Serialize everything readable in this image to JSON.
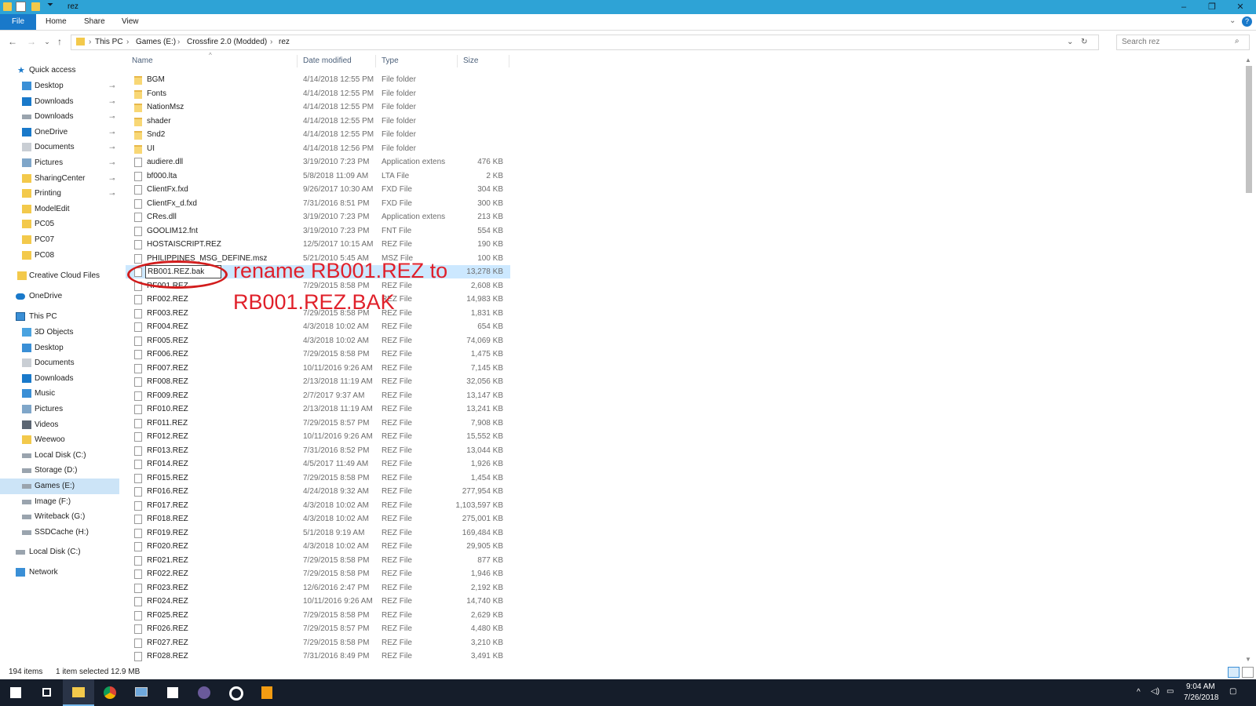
{
  "window": {
    "title": "rez",
    "controls": [
      "–",
      "❐",
      "✕"
    ]
  },
  "ribbon": {
    "tabs": [
      "File",
      "Home",
      "Share",
      "View"
    ]
  },
  "address": {
    "breadcrumb": [
      "This PC",
      "Games (E:)",
      "Crossfire 2.0 (Modded)",
      "rez"
    ],
    "search_placeholder": "Search rez"
  },
  "sidebar": {
    "quick_access_label": "Quick access",
    "quick_access": [
      {
        "label": "Desktop",
        "icon": "desktop-icon",
        "pinned": true
      },
      {
        "label": "Downloads",
        "icon": "downloads-icon",
        "pinned": true
      },
      {
        "label": "Downloads",
        "icon": "drive-icon",
        "pinned": true
      },
      {
        "label": "OneDrive",
        "icon": "cloud-icon",
        "pinned": true
      },
      {
        "label": "Documents",
        "icon": "documents-icon",
        "pinned": true
      },
      {
        "label": "Pictures",
        "icon": "pictures-icon",
        "pinned": true
      },
      {
        "label": "SharingCenter",
        "icon": "folder-icon",
        "pinned": true
      },
      {
        "label": "Printing",
        "icon": "folder-icon",
        "pinned": true
      },
      {
        "label": "ModelEdit",
        "icon": "folder-icon",
        "pinned": false
      },
      {
        "label": "PC05",
        "icon": "folder-icon",
        "pinned": false
      },
      {
        "label": "PC07",
        "icon": "folder-icon",
        "pinned": false
      },
      {
        "label": "PC08",
        "icon": "folder-icon",
        "pinned": false
      }
    ],
    "creative_cloud": "Creative Cloud Files",
    "onedrive": "OneDrive",
    "this_pc_label": "This PC",
    "this_pc": [
      {
        "label": "3D Objects",
        "icon": "cube-icon"
      },
      {
        "label": "Desktop",
        "icon": "desktop-icon"
      },
      {
        "label": "Documents",
        "icon": "documents-icon"
      },
      {
        "label": "Downloads",
        "icon": "downloads-icon"
      },
      {
        "label": "Music",
        "icon": "music-icon"
      },
      {
        "label": "Pictures",
        "icon": "pictures-icon"
      },
      {
        "label": "Videos",
        "icon": "videos-icon"
      },
      {
        "label": "Weewoo",
        "icon": "folder-icon"
      },
      {
        "label": "Local Disk (C:)",
        "icon": "drive-icon"
      },
      {
        "label": "Storage (D:)",
        "icon": "drive-icon"
      },
      {
        "label": "Games (E:)",
        "icon": "drive-icon",
        "selected": true
      },
      {
        "label": "Image (F:)",
        "icon": "drive-icon"
      },
      {
        "label": "Writeback (G:)",
        "icon": "drive-icon"
      },
      {
        "label": "SSDCache (H:)",
        "icon": "drive-icon"
      }
    ],
    "local_disk": "Local Disk (C:)",
    "network": "Network"
  },
  "columns": [
    "Name",
    "Date modified",
    "Type",
    "Size"
  ],
  "files": [
    {
      "name": "BGM",
      "date": "4/14/2018 12:55 PM",
      "type": "File folder",
      "size": "",
      "kind": "folder"
    },
    {
      "name": "Fonts",
      "date": "4/14/2018 12:55 PM",
      "type": "File folder",
      "size": "",
      "kind": "folder"
    },
    {
      "name": "NationMsz",
      "date": "4/14/2018 12:55 PM",
      "type": "File folder",
      "size": "",
      "kind": "folder"
    },
    {
      "name": "shader",
      "date": "4/14/2018 12:55 PM",
      "type": "File folder",
      "size": "",
      "kind": "folder"
    },
    {
      "name": "Snd2",
      "date": "4/14/2018 12:55 PM",
      "type": "File folder",
      "size": "",
      "kind": "folder"
    },
    {
      "name": "UI",
      "date": "4/14/2018 12:56 PM",
      "type": "File folder",
      "size": "",
      "kind": "folder"
    },
    {
      "name": "audiere.dll",
      "date": "3/19/2010 7:23 PM",
      "type": "Application extens",
      "size": "476 KB",
      "kind": "file"
    },
    {
      "name": "bf000.lta",
      "date": "5/8/2018 11:09 AM",
      "type": "LTA File",
      "size": "2 KB",
      "kind": "file"
    },
    {
      "name": "ClientFx.fxd",
      "date": "9/26/2017 10:30 AM",
      "type": "FXD File",
      "size": "304 KB",
      "kind": "file"
    },
    {
      "name": "ClientFx_d.fxd",
      "date": "7/31/2016 8:51 PM",
      "type": "FXD File",
      "size": "300 KB",
      "kind": "file"
    },
    {
      "name": "CRes.dll",
      "date": "3/19/2010 7:23 PM",
      "type": "Application extens",
      "size": "213 KB",
      "kind": "file"
    },
    {
      "name": "GOOLIM12.fnt",
      "date": "3/19/2010 7:23 PM",
      "type": "FNT File",
      "size": "554 KB",
      "kind": "file"
    },
    {
      "name": "HOSTAISCRIPT.REZ",
      "date": "12/5/2017 10:15 AM",
      "type": "REZ File",
      "size": "190 KB",
      "kind": "file"
    },
    {
      "name": "PHILIPPINES_MSG_DEFINE.msz",
      "date": "5/21/2010 5:45 AM",
      "type": "MSZ File",
      "size": "100 KB",
      "kind": "file"
    },
    {
      "name": "RB001.REZ.bak",
      "date": "",
      "type": "",
      "size": "13,278 KB",
      "kind": "file",
      "renaming": true
    },
    {
      "name": "RF001.REZ",
      "date": "7/29/2015 8:58 PM",
      "type": "REZ File",
      "size": "2,608 KB",
      "kind": "file"
    },
    {
      "name": "RF002.REZ",
      "date": "",
      "type": "REZ File",
      "size": "14,983 KB",
      "kind": "file"
    },
    {
      "name": "RF003.REZ",
      "date": "7/29/2015 8:58 PM",
      "type": "REZ File",
      "size": "1,831 KB",
      "kind": "file"
    },
    {
      "name": "RF004.REZ",
      "date": "4/3/2018 10:02 AM",
      "type": "REZ File",
      "size": "654 KB",
      "kind": "file"
    },
    {
      "name": "RF005.REZ",
      "date": "4/3/2018 10:02 AM",
      "type": "REZ File",
      "size": "74,069 KB",
      "kind": "file"
    },
    {
      "name": "RF006.REZ",
      "date": "7/29/2015 8:58 PM",
      "type": "REZ File",
      "size": "1,475 KB",
      "kind": "file"
    },
    {
      "name": "RF007.REZ",
      "date": "10/11/2016 9:26 AM",
      "type": "REZ File",
      "size": "7,145 KB",
      "kind": "file"
    },
    {
      "name": "RF008.REZ",
      "date": "2/13/2018 11:19 AM",
      "type": "REZ File",
      "size": "32,056 KB",
      "kind": "file"
    },
    {
      "name": "RF009.REZ",
      "date": "2/7/2017 9:37 AM",
      "type": "REZ File",
      "size": "13,147 KB",
      "kind": "file"
    },
    {
      "name": "RF010.REZ",
      "date": "2/13/2018 11:19 AM",
      "type": "REZ File",
      "size": "13,241 KB",
      "kind": "file"
    },
    {
      "name": "RF011.REZ",
      "date": "7/29/2015 8:57 PM",
      "type": "REZ File",
      "size": "7,908 KB",
      "kind": "file"
    },
    {
      "name": "RF012.REZ",
      "date": "10/11/2016 9:26 AM",
      "type": "REZ File",
      "size": "15,552 KB",
      "kind": "file"
    },
    {
      "name": "RF013.REZ",
      "date": "7/31/2016 8:52 PM",
      "type": "REZ File",
      "size": "13,044 KB",
      "kind": "file"
    },
    {
      "name": "RF014.REZ",
      "date": "4/5/2017 11:49 AM",
      "type": "REZ File",
      "size": "1,926 KB",
      "kind": "file"
    },
    {
      "name": "RF015.REZ",
      "date": "7/29/2015 8:58 PM",
      "type": "REZ File",
      "size": "1,454 KB",
      "kind": "file"
    },
    {
      "name": "RF016.REZ",
      "date": "4/24/2018 9:32 AM",
      "type": "REZ File",
      "size": "277,954 KB",
      "kind": "file"
    },
    {
      "name": "RF017.REZ",
      "date": "4/3/2018 10:02 AM",
      "type": "REZ File",
      "size": "1,103,597 KB",
      "kind": "file"
    },
    {
      "name": "RF018.REZ",
      "date": "4/3/2018 10:02 AM",
      "type": "REZ File",
      "size": "275,001 KB",
      "kind": "file"
    },
    {
      "name": "RF019.REZ",
      "date": "5/1/2018 9:19 AM",
      "type": "REZ File",
      "size": "169,484 KB",
      "kind": "file"
    },
    {
      "name": "RF020.REZ",
      "date": "4/3/2018 10:02 AM",
      "type": "REZ File",
      "size": "29,905 KB",
      "kind": "file"
    },
    {
      "name": "RF021.REZ",
      "date": "7/29/2015 8:58 PM",
      "type": "REZ File",
      "size": "877 KB",
      "kind": "file"
    },
    {
      "name": "RF022.REZ",
      "date": "7/29/2015 8:58 PM",
      "type": "REZ File",
      "size": "1,946 KB",
      "kind": "file"
    },
    {
      "name": "RF023.REZ",
      "date": "12/6/2016 2:47 PM",
      "type": "REZ File",
      "size": "2,192 KB",
      "kind": "file"
    },
    {
      "name": "RF024.REZ",
      "date": "10/11/2016 9:26 AM",
      "type": "REZ File",
      "size": "14,740 KB",
      "kind": "file"
    },
    {
      "name": "RF025.REZ",
      "date": "7/29/2015 8:58 PM",
      "type": "REZ File",
      "size": "2,629 KB",
      "kind": "file"
    },
    {
      "name": "RF026.REZ",
      "date": "7/29/2015 8:57 PM",
      "type": "REZ File",
      "size": "4,480 KB",
      "kind": "file"
    },
    {
      "name": "RF027.REZ",
      "date": "7/29/2015 8:58 PM",
      "type": "REZ File",
      "size": "3,210 KB",
      "kind": "file"
    },
    {
      "name": "RF028.REZ",
      "date": "7/31/2016 8:49 PM",
      "type": "REZ File",
      "size": "3,491 KB",
      "kind": "file"
    }
  ],
  "annotation": {
    "line1": "rename RB001.REZ to",
    "line2": "RB001.REZ.BAK",
    "color": "#e0202a"
  },
  "status": {
    "items": "194 items",
    "selected": "1 item selected  12.9 MB"
  },
  "taskbar": {
    "apps": [
      "windows-start-icon",
      "task-view-icon",
      "file-explorer-icon",
      "chrome-icon",
      "remote-desktop-icon",
      "sticky-notes-icon",
      "obs-icon",
      "target-icon",
      "sublime-text-icon"
    ],
    "time": "9:04 AM",
    "date": "7/26/2018"
  },
  "colors": {
    "titlebar": "#2ea3d6",
    "file_tab": "#1979ca",
    "selection": "#cce8ff",
    "taskbar": "#151d2a"
  }
}
